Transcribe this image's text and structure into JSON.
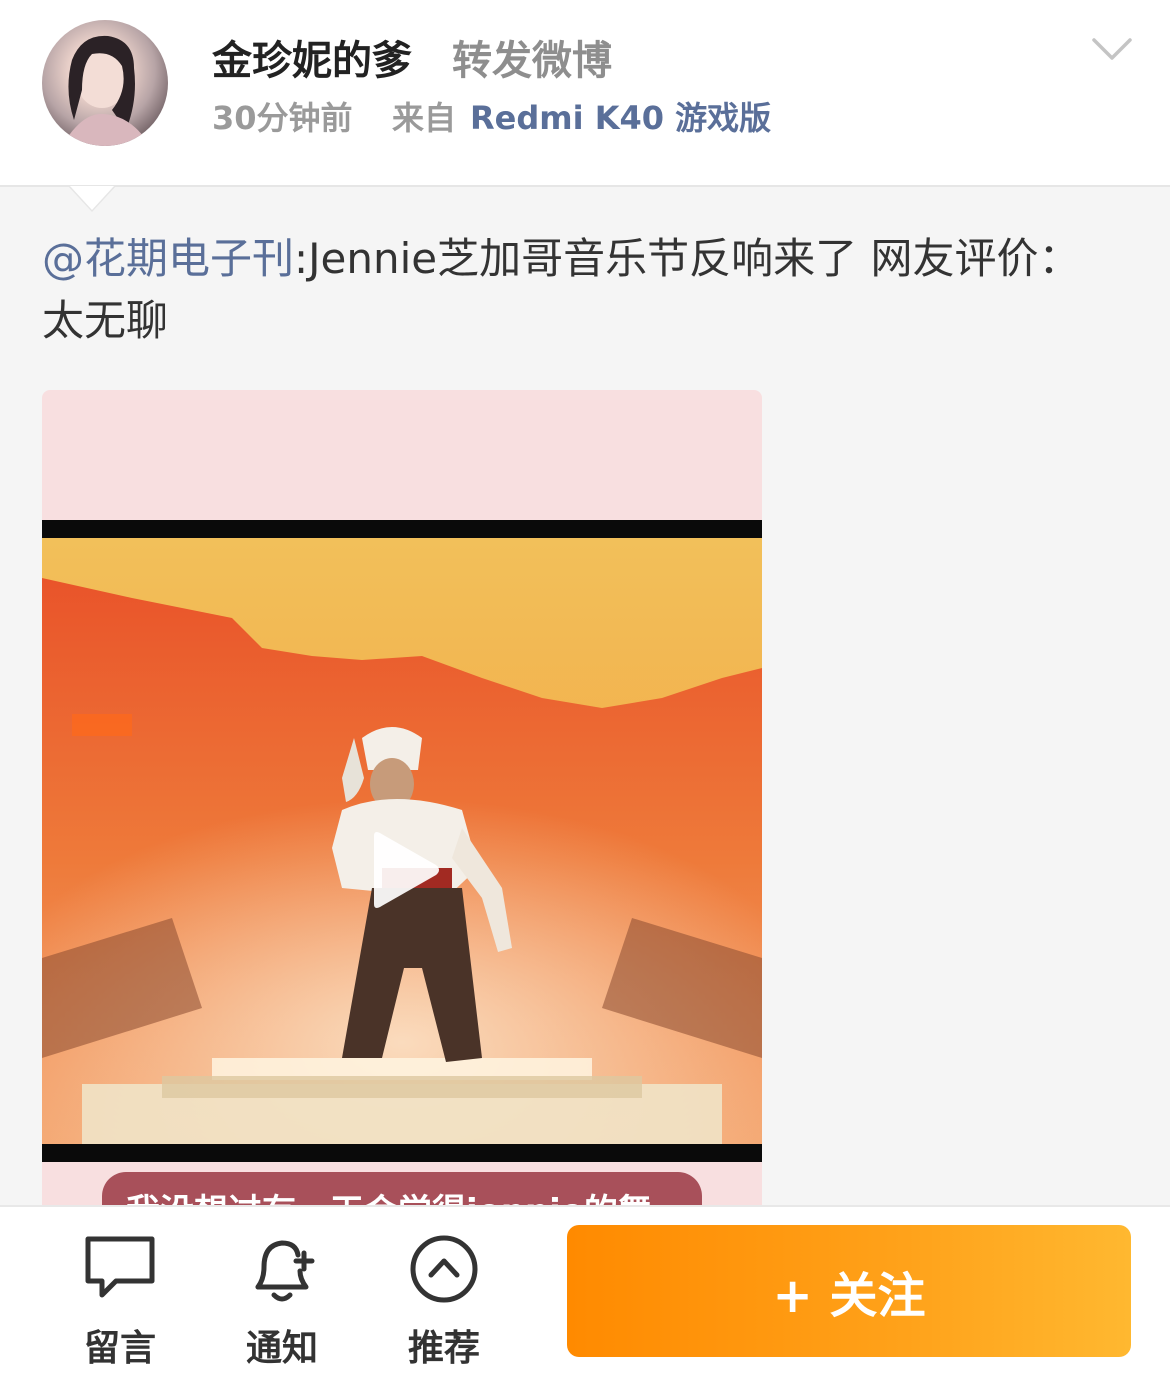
{
  "header": {
    "user_name": "金珍妮的爹",
    "repost_label": "转发微博",
    "time": "30分钟前",
    "from_label": "来自",
    "device": "Redmi K40 游戏版"
  },
  "post": {
    "mention": "@花期电子刊",
    "text": ":Jennie芝加哥音乐节反响来了 网友评价：太无聊"
  },
  "video": {
    "caption": "我没想过有一天会觉得jennie的舞"
  },
  "toolbar": {
    "comment_label": "留言",
    "notify_label": "通知",
    "recommend_label": "推荐",
    "follow_label": "+ 关注"
  },
  "colors": {
    "link": "#5a6f99",
    "follow_gradient_start": "#ff8a00",
    "follow_gradient_end": "#ffb830"
  }
}
